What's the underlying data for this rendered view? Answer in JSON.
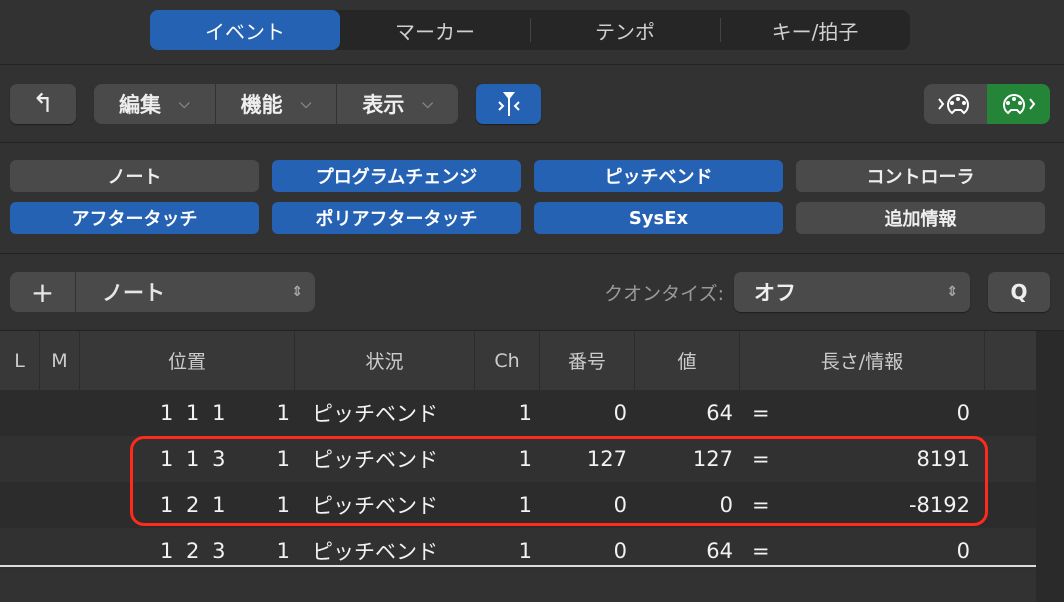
{
  "tabs": [
    {
      "label": "イベント",
      "active": true
    },
    {
      "label": "マーカー"
    },
    {
      "label": "テンポ"
    },
    {
      "label": "キー/拍子"
    }
  ],
  "toolbar": {
    "up_icon": "↰",
    "menus": [
      "編集",
      "機能",
      "表示"
    ],
    "catch_icon": "catch-icon"
  },
  "filters": [
    {
      "label": "ノート",
      "on": false
    },
    {
      "label": "プログラムチェンジ",
      "on": true
    },
    {
      "label": "ピッチベンド",
      "on": true
    },
    {
      "label": "コントローラ",
      "on": false
    },
    {
      "label": "アフタータッチ",
      "on": true
    },
    {
      "label": "ポリアフタータッチ",
      "on": true
    },
    {
      "label": "SysEx",
      "on": true
    },
    {
      "label": "追加情報",
      "on": false
    }
  ],
  "create": {
    "plus": "+",
    "type": "ノート"
  },
  "quantize": {
    "label": "クオンタイズ:",
    "value": "オフ",
    "button": "Q"
  },
  "columns": [
    "L",
    "M",
    "位置",
    "状況",
    "Ch",
    "番号",
    "値",
    "長さ/情報"
  ],
  "rows": [
    {
      "pos": "1 1 1",
      "tick": "1",
      "status": "ピッチベンド",
      "ch": "1",
      "num": "0",
      "val": "64",
      "eq": "=",
      "info": "0"
    },
    {
      "pos": "1 1 3",
      "tick": "1",
      "status": "ピッチベンド",
      "ch": "1",
      "num": "127",
      "val": "127",
      "eq": "=",
      "info": "8191"
    },
    {
      "pos": "1 2 1",
      "tick": "1",
      "status": "ピッチベンド",
      "ch": "1",
      "num": "0",
      "val": "0",
      "eq": "=",
      "info": "-8192"
    },
    {
      "pos": "1 2 3",
      "tick": "1",
      "status": "ピッチベンド",
      "ch": "1",
      "num": "0",
      "val": "64",
      "eq": "=",
      "info": "0"
    }
  ],
  "colors": {
    "accent": "#2562b3",
    "midi_out": "#248437",
    "highlight": "#ff2a1a"
  }
}
